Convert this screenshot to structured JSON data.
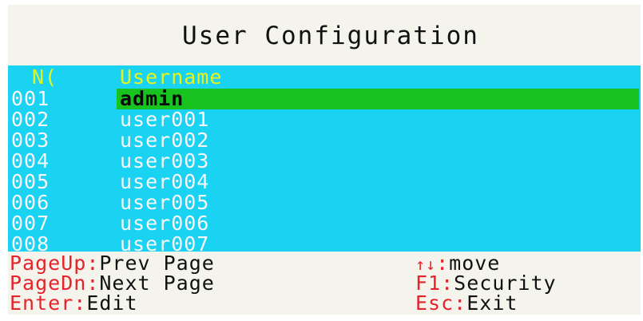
{
  "title": "User Configuration",
  "table": {
    "header": {
      "no": "N(",
      "username": "Username"
    },
    "rows": [
      {
        "no": "001",
        "username": "admin"
      },
      {
        "no": "002",
        "username": "user001"
      },
      {
        "no": "003",
        "username": "user002"
      },
      {
        "no": "004",
        "username": "user003"
      },
      {
        "no": "005",
        "username": "user004"
      },
      {
        "no": "006",
        "username": "user005"
      },
      {
        "no": "007",
        "username": "user006"
      },
      {
        "no": "008",
        "username": "user007"
      }
    ],
    "selected_index": 0
  },
  "footer": {
    "pageup": {
      "key": "PageUp",
      "sep": ":",
      "desc": "Prev Page"
    },
    "pagedn": {
      "key": "PageDn",
      "sep": ":",
      "desc": "Next Page"
    },
    "enter": {
      "key": "Enter",
      "sep": ":",
      "desc": "Edit"
    },
    "move": {
      "key": "↑↓",
      "sep": ":",
      "desc": "move"
    },
    "f1": {
      "key": "F1",
      "sep": ":",
      "desc": "Security"
    },
    "esc": {
      "key": "Esc",
      "sep": ":",
      "desc": "Exit"
    }
  },
  "colors": {
    "background": "#f4f3ec",
    "table_bg": "#1ad3f3",
    "header_text": "#e8f31a",
    "row_text": "#f7f7f7",
    "selected_bg": "#19c31f",
    "key_text": "#e5232a",
    "desc_text": "#111111"
  },
  "icons": {
    "move_keys": "up-down-arrows-icon"
  }
}
